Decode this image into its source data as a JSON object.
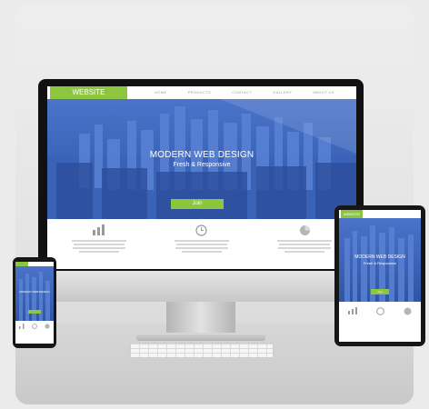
{
  "colors": {
    "accent": "#8cc63f",
    "hero_blue": "#3d66bb"
  },
  "desktop": {
    "logo": "WEBSITE",
    "nav": [
      "HOME",
      "PRODUCTS",
      "CONTACT",
      "GALLERY",
      "ABOUT US"
    ],
    "hero_title": "MODERN WEB DESIGN",
    "hero_subtitle": "Fresh & Responsive",
    "cta": "Join",
    "features": [
      {
        "icon": "bar-chart-icon"
      },
      {
        "icon": "clock-icon"
      },
      {
        "icon": "pie-chart-icon"
      }
    ]
  },
  "tablet": {
    "logo": "WEBSITE",
    "hero_title": "MODERN WEB DESIGN",
    "hero_subtitle": "Fresh & Responsive",
    "cta": "Join"
  },
  "phone": {
    "hero_title": "MODERN WEB DESIGN"
  }
}
